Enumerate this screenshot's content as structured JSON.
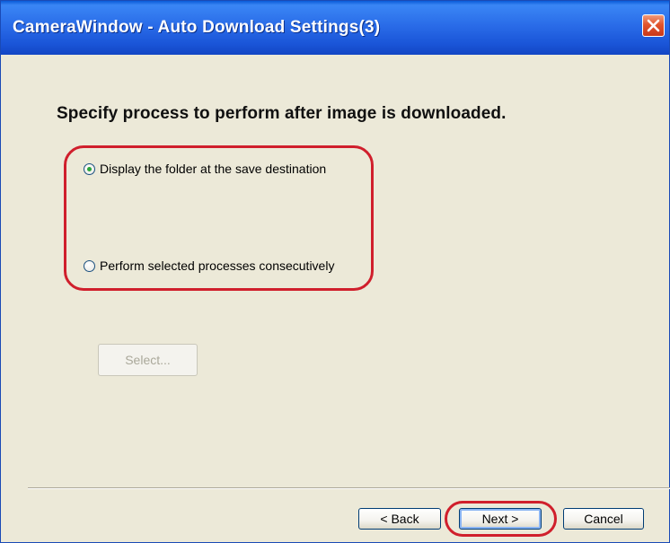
{
  "window": {
    "title": "CameraWindow - Auto Download Settings(3)"
  },
  "main": {
    "prompt": "Specify process to perform after image is downloaded.",
    "options": [
      {
        "label": "Display the folder at the save destination",
        "checked": true
      },
      {
        "label": "Perform selected processes consecutively",
        "checked": false
      }
    ],
    "select_button": "Select..."
  },
  "footer": {
    "back_label": "< Back",
    "next_label": "Next >",
    "cancel_label": "Cancel"
  },
  "colors": {
    "titlebar": "#2a6ce8",
    "highlight": "#d01f2c",
    "background": "#ece9d8"
  }
}
